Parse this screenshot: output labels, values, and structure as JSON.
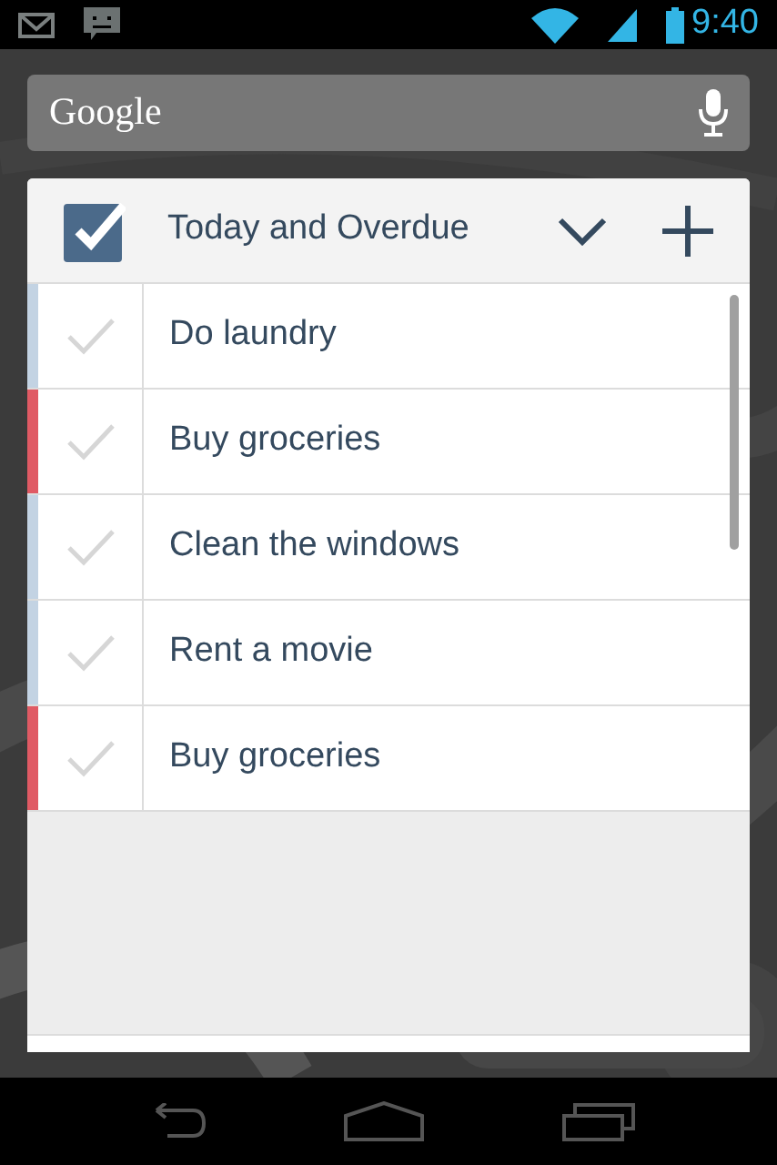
{
  "status_bar": {
    "time": "9:40"
  },
  "search": {
    "placeholder": "Google"
  },
  "widget": {
    "title": "Today and Overdue"
  },
  "tasks": [
    {
      "name": "Do laundry",
      "color": "#c3d3e3",
      "checked": false
    },
    {
      "name": "Buy groceries",
      "color": "#e05a64",
      "checked": false
    },
    {
      "name": "Clean the windows",
      "color": "#c3d3e3",
      "checked": false
    },
    {
      "name": "Rent a movie",
      "color": "#c3d3e3",
      "checked": false
    },
    {
      "name": "Buy groceries",
      "color": "#e05a64",
      "checked": false
    }
  ]
}
